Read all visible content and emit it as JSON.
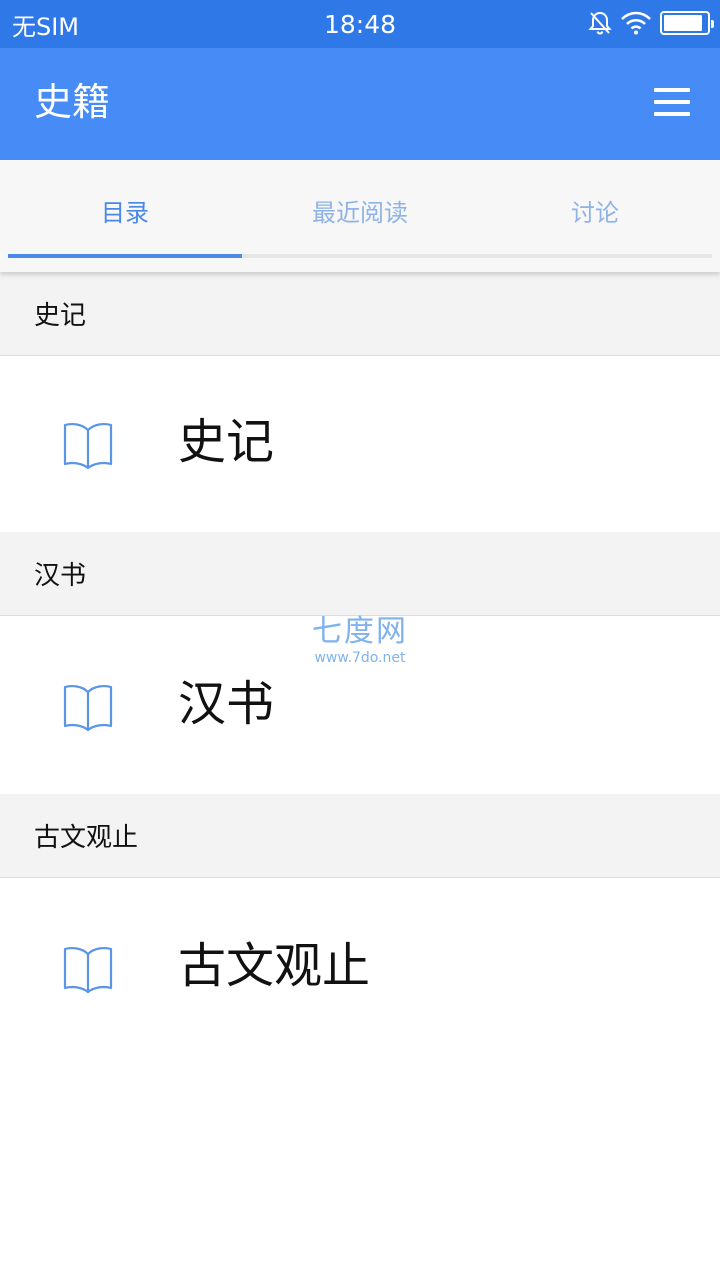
{
  "status_bar": {
    "carrier": "无SIM",
    "time": "18:48",
    "battery_level": 0.9,
    "icons": [
      "mute-bell-icon",
      "wifi-icon",
      "battery-icon"
    ]
  },
  "app_bar": {
    "title": "史籍",
    "menu_icon": "hamburger-menu-icon"
  },
  "tabs": [
    {
      "label": "目录",
      "active": true
    },
    {
      "label": "最近阅读",
      "active": false
    },
    {
      "label": "讨论",
      "active": false
    }
  ],
  "sections": [
    {
      "header": "史记",
      "book": "史记",
      "icon": "book-icon"
    },
    {
      "header": "汉书",
      "book": "汉书",
      "icon": "book-icon"
    },
    {
      "header": "古文观止",
      "book": "古文观止",
      "icon": "book-icon"
    }
  ],
  "watermark": {
    "logo": "七度网",
    "url": "www.7do.net"
  },
  "colors": {
    "status_bar": "#2e78e8",
    "app_bar": "#478cf6",
    "accent": "#4a8ae8",
    "section_bg": "#f3f3f3"
  }
}
